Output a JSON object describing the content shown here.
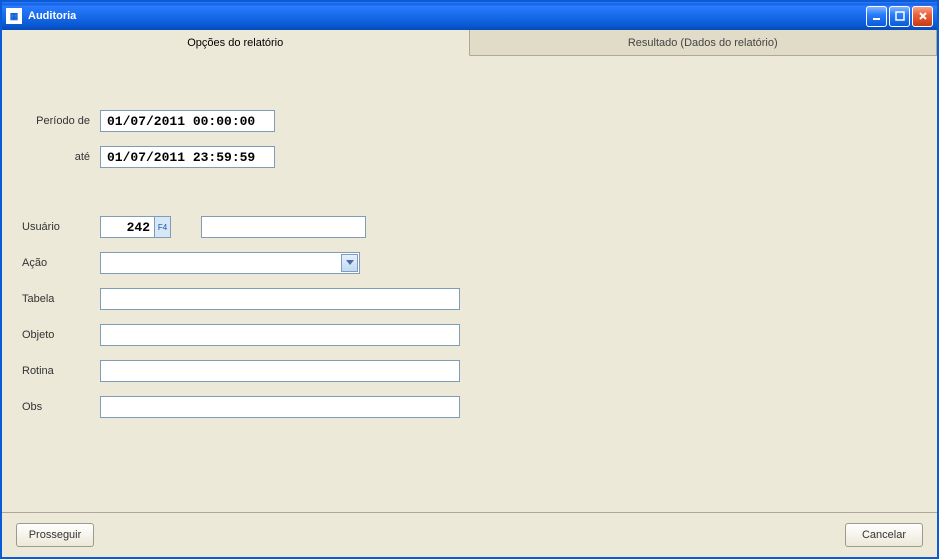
{
  "window": {
    "title": "Auditoria"
  },
  "tabs": {
    "options": "Opções do relatório",
    "results": "Resultado (Dados do relatório)"
  },
  "form": {
    "period_from_label": "Período de",
    "period_to_label": "até",
    "period_from_value": "01/07/2011 00:00:00",
    "period_to_value": "01/07/2011 23:59:59",
    "user_label": "Usuário",
    "user_code": "242",
    "user_name": "",
    "action_label": "Ação",
    "action_value": "",
    "table_label": "Tabela",
    "table_value": "",
    "object_label": "Objeto",
    "object_value": "",
    "routine_label": "Rotina",
    "routine_value": "",
    "obs_label": "Obs",
    "obs_value": "",
    "lookup_hint": "F4"
  },
  "buttons": {
    "proceed": "Prosseguir",
    "cancel": "Cancelar"
  }
}
